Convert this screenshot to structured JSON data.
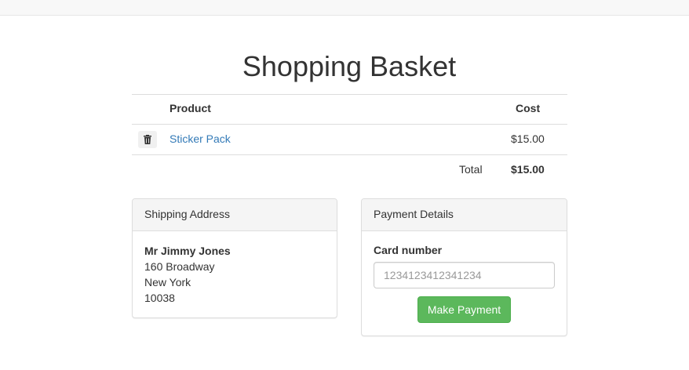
{
  "page": {
    "title": "Shopping Basket"
  },
  "basket": {
    "headers": {
      "product": "Product",
      "cost": "Cost"
    },
    "items": [
      {
        "name": "Sticker Pack",
        "price": "$15.00",
        "remove_icon": "trash-icon"
      }
    ],
    "total_label": "Total",
    "total_value": "$15.00"
  },
  "shipping": {
    "heading": "Shipping Address",
    "name": "Mr Jimmy Jones",
    "street": "160 Broadway",
    "city": "New York",
    "postcode": "10038"
  },
  "payment": {
    "heading": "Payment Details",
    "card_label": "Card number",
    "card_placeholder": "1234123412341234",
    "card_value": "",
    "button_label": "Make Payment"
  },
  "colors": {
    "link": "#337ab7",
    "success": "#5cb85c"
  }
}
